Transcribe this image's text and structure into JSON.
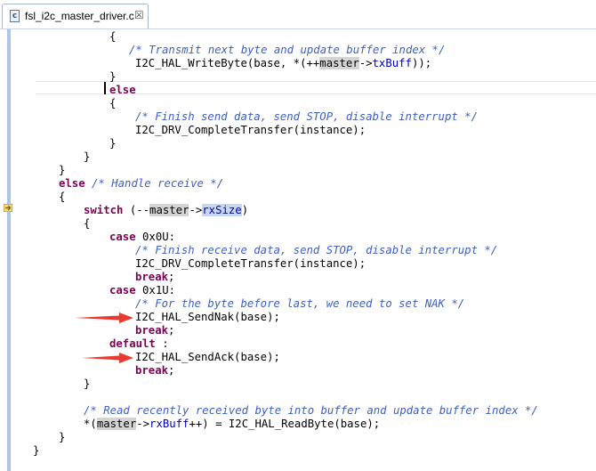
{
  "tab": {
    "file_icon": "c-source-file-icon",
    "file_icon_letter": "c",
    "title": "fsl_i2c_master_driver.c",
    "close": "☒"
  },
  "code": {
    "l1": "{",
    "l2": "/* Transmit next byte and update buffer index */",
    "l3a": "I2C_HAL_WriteByte(base, *(++",
    "l3b": "master",
    "l3c": "->",
    "l3d": "txBuff",
    "l3e": "));",
    "l4": "}",
    "l5": "else",
    "l6": "{",
    "l7": "/* Finish send data, send STOP, disable interrupt */",
    "l8": "I2C_DRV_CompleteTransfer(instance);",
    "l9": "}",
    "l10": "}",
    "l11": "}",
    "l12a": "else",
    "l12b": "/* Handle receive */",
    "l13": "{",
    "l14a": "switch",
    "l14b": " (--",
    "l14c": "master",
    "l14d": "->",
    "l14e": "rxSize",
    "l14f": ")",
    "l15": "{",
    "l16a": "case",
    "l16b": " 0x0U:",
    "l17": "/* Finish receive data, send STOP, disable interrupt */",
    "l18": "I2C_DRV_CompleteTransfer(instance);",
    "l19": "break",
    "l19b": ";",
    "l20a": "case",
    "l20b": " 0x1U:",
    "l21": "/* For the byte before last, we need to set NAK */",
    "l22": "I2C_HAL_SendNak(base);",
    "l23": "break",
    "l23b": ";",
    "l24a": "default",
    "l24b": " :",
    "l25": "I2C_HAL_SendAck(base);",
    "l26": "break",
    "l26b": ";",
    "l27": "}",
    "l28": "/* Read recently received byte into buffer and update buffer index */",
    "l29a": "*(",
    "l29b": "master",
    "l29c": "->",
    "l29d": "rxBuff",
    "l29e": "++) = I2C_HAL_ReadByte(base);",
    "l30": "}",
    "l31": "}"
  },
  "colors": {
    "keyword": "#7f0055",
    "comment": "#3f5fbf",
    "field": "#0000c0",
    "annotation_arrow": "#e83a30"
  }
}
